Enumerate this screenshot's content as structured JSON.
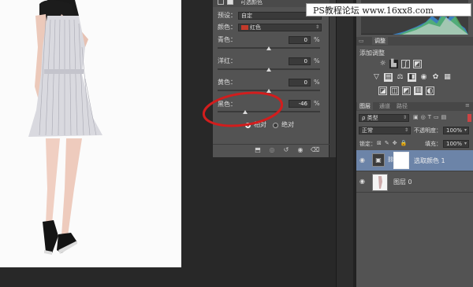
{
  "watermark": "PS教程论坛 www.16xx8.com",
  "properties": {
    "header_title": "可选颜色",
    "preset_label": "预设：",
    "preset_value": "自定",
    "colors_label": "颜色：",
    "colors_value": "红色",
    "colors_swatch": "#c23a2a",
    "sliders": [
      {
        "label": "青色：",
        "value": "0",
        "unit": "%",
        "level": 0
      },
      {
        "label": "洋红：",
        "value": "0",
        "unit": "%",
        "level": 0
      },
      {
        "label": "黄色：",
        "value": "0",
        "unit": "%",
        "level": 0
      },
      {
        "label": "黑色：",
        "value": "-46",
        "unit": "%",
        "level": -46
      }
    ],
    "mode_relative": "相对",
    "mode_absolute": "绝对",
    "mode_selected": "relative"
  },
  "histogram": {
    "type": "area"
  },
  "adjustments": {
    "tab_label": "调整",
    "add_label": "添加调整",
    "icon_rows": [
      [
        "brightness-icon",
        "levels-icon",
        "curves-icon",
        "exposure-icon"
      ],
      [
        "vibrance-icon",
        "hue-saturation-icon",
        "color-balance-icon",
        "black-white-icon",
        "photo-filter-icon",
        "channel-mixer-icon",
        "color-lookup-icon"
      ],
      [
        "invert-icon",
        "posterize-icon",
        "threshold-icon",
        "gradient-map-icon",
        "selective-color-icon"
      ]
    ]
  },
  "layers_panel": {
    "tabs": [
      "图层",
      "通道",
      "路径"
    ],
    "filter_label": "ρ 类型",
    "blend_mode": "正常",
    "opacity_label": "不透明度：",
    "opacity_value": "100%",
    "lock_label": "锁定：",
    "fill_label": "填充：",
    "fill_value": "100%",
    "layers": [
      {
        "name": "选取颜色 1",
        "selected": true
      },
      {
        "name": "图层 0",
        "selected": false
      }
    ]
  },
  "colors": {
    "highlight": "#6c84a8",
    "annotation": "#d21d1d"
  }
}
